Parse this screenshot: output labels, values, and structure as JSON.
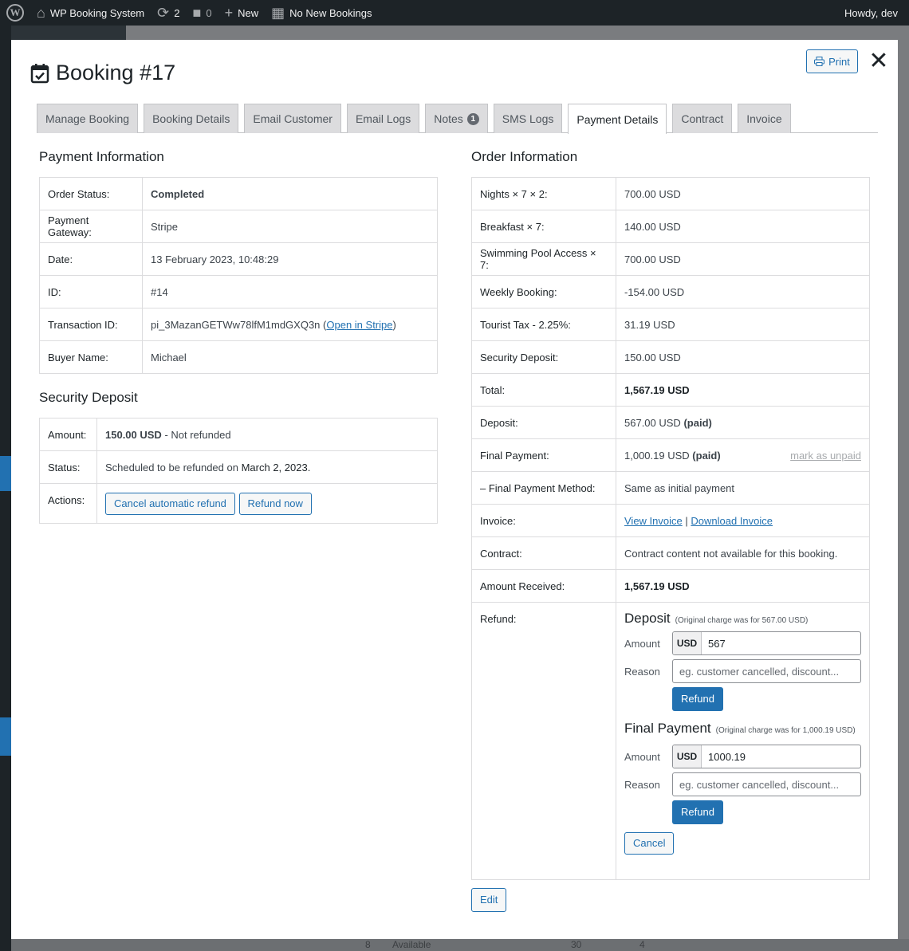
{
  "adminbar": {
    "site_name": "WP Booking System",
    "updates_count": "2",
    "comments_count": "0",
    "new_label": "New",
    "bookings_label": "No New Bookings",
    "howdy": "Howdy, dev"
  },
  "modal": {
    "title": "Booking #17",
    "print_label": "Print",
    "close_label": "✕",
    "tabs": [
      {
        "label": "Manage Booking"
      },
      {
        "label": "Booking Details"
      },
      {
        "label": "Email Customer"
      },
      {
        "label": "Email Logs"
      },
      {
        "label": "Notes",
        "count": "1"
      },
      {
        "label": "SMS Logs"
      },
      {
        "label": "Payment Details",
        "active": true
      },
      {
        "label": "Contract"
      },
      {
        "label": "Invoice"
      }
    ]
  },
  "payment_info": {
    "heading": "Payment Information",
    "rows": [
      {
        "label": "Order Status:",
        "value": "Completed"
      },
      {
        "label": "Payment Gateway:",
        "value": "Stripe"
      },
      {
        "label": "Date:",
        "value": "13 February 2023, 10:48:29"
      },
      {
        "label": "ID:",
        "value": "#14"
      },
      {
        "label": "Transaction ID:",
        "value": "pi_3MazanGETWw78lfM1mdGXQ3n",
        "link": "Open in Stripe"
      },
      {
        "label": "Buyer Name:",
        "value": "Michael"
      }
    ]
  },
  "security_deposit": {
    "heading": "Security Deposit",
    "amount_label": "Amount:",
    "amount_value": "150.00 USD",
    "amount_status": " - Not refunded",
    "status_label": "Status:",
    "status_text": "Scheduled to be refunded on ",
    "status_date": "March 2, 2023.",
    "actions_label": "Actions:",
    "cancel_refund_label": "Cancel automatic refund",
    "refund_now_label": "Refund now"
  },
  "order_info": {
    "heading": "Order Information",
    "rows": [
      {
        "label": "Nights × 7 × 2:",
        "value": "700.00 USD"
      },
      {
        "label": "Breakfast × 7:",
        "value": "140.00 USD"
      },
      {
        "label": "Swimming Pool Access × 7:",
        "value": "700.00 USD"
      },
      {
        "label": "Weekly Booking:",
        "value": "-154.00 USD"
      },
      {
        "label": "Tourist Tax - 2.25%:",
        "value": "31.19 USD"
      },
      {
        "label": "Security Deposit:",
        "value": "150.00 USD"
      },
      {
        "label": "Total:",
        "value": "1,567.19 USD"
      },
      {
        "label": "Deposit:",
        "value": "567.00 USD",
        "paid": "(paid)"
      },
      {
        "label": "Final Payment:",
        "value": "1,000.19 USD",
        "paid": "(paid)",
        "action": "mark as unpaid"
      },
      {
        "label": "– Final Payment Method:",
        "value": "Same as initial payment"
      },
      {
        "label": "Invoice:",
        "link1": "View Invoice",
        "sep": "|",
        "link2": "Download Invoice"
      },
      {
        "label": "Contract:",
        "value": "Contract content not available for this booking."
      },
      {
        "label": "Amount Received:",
        "value": "1,567.19 USD"
      }
    ],
    "refund": {
      "label": "Refund:",
      "deposit": {
        "title": "Deposit",
        "note": "(Original charge was for 567.00 USD)",
        "amount_label": "Amount",
        "currency": "USD",
        "amount_value": "567",
        "reason_label": "Reason",
        "reason_placeholder": "eg. customer cancelled, discount...",
        "button_label": "Refund"
      },
      "final": {
        "title": "Final Payment",
        "note": "(Original charge was for 1,000.19 USD)",
        "amount_label": "Amount",
        "currency": "USD",
        "amount_value": "1000.19",
        "reason_label": "Reason",
        "reason_placeholder": "eg. customer cancelled, discount...",
        "button_label": "Refund"
      },
      "cancel_label": "Cancel"
    },
    "edit_label": "Edit"
  },
  "background": {
    "select_value": "Available",
    "num1": "8",
    "num2": "30",
    "num3": "4"
  }
}
